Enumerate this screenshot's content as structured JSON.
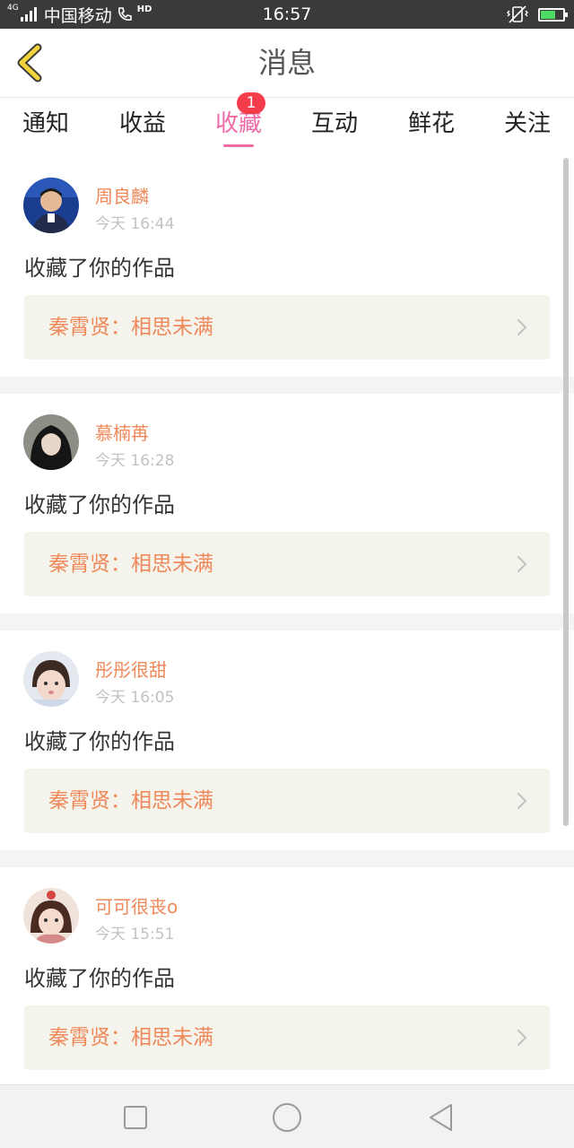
{
  "status_bar": {
    "network": "4G",
    "carrier": "中国移动",
    "hd": "HD",
    "time": "16:57",
    "battery_level": 0.6
  },
  "header": {
    "title": "消息",
    "back_icon": "chevron-left-icon"
  },
  "tabs": [
    {
      "label": "通知",
      "active": false
    },
    {
      "label": "收益",
      "active": false
    },
    {
      "label": "收藏",
      "active": true,
      "badge": "1"
    },
    {
      "label": "互动",
      "active": false
    },
    {
      "label": "鲜花",
      "active": false
    },
    {
      "label": "关注",
      "active": false
    }
  ],
  "messages": [
    {
      "name": "周良麟",
      "time": "今天 16:44",
      "action": "收藏了你的作品",
      "work": "秦霄贤：相思未满"
    },
    {
      "name": "慕楠苒",
      "time": "今天 16:28",
      "action": "收藏了你的作品",
      "work": "秦霄贤：相思未满"
    },
    {
      "name": "彤彤很甜",
      "time": "今天 16:05",
      "action": "收藏了你的作品",
      "work": "秦霄贤：相思未满"
    },
    {
      "name": "可可很丧o",
      "time": "今天 15:51",
      "action": "收藏了你的作品",
      "work": "秦霄贤：相思未满"
    }
  ],
  "colors": {
    "accent_pink": "#f06aa6",
    "name_orange": "#f0895a",
    "badge_red": "#f43c4a",
    "back_yellow": "#f2d33c"
  }
}
